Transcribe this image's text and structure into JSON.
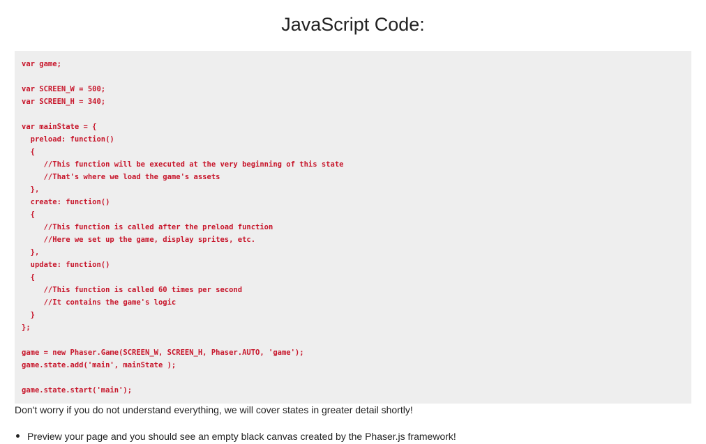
{
  "title": "JavaScript Code:",
  "code_lines": [
    "var game;",
    "",
    "var SCREEN_W = 500;",
    "var SCREEN_H = 340;",
    "",
    "var mainState = {",
    "  preload: function()",
    "  {",
    "     //This function will be executed at the very beginning of this state",
    "     //That's where we load the game's assets",
    "  },",
    "  create: function()",
    "  {",
    "     //This function is called after the preload function",
    "     //Here we set up the game, display sprites, etc.",
    "  },",
    "  update: function()",
    "  {",
    "     //This function is called 60 times per second",
    "     //It contains the game's logic",
    "  }",
    "};",
    "",
    "game = new Phaser.Game(SCREEN_W, SCREEN_H, Phaser.AUTO, 'game');",
    "game.state.add('main', mainState );",
    "",
    "game.state.start('main');"
  ],
  "note": "Don't worry if you do not understand everything, we will cover states in greater detail shortly!",
  "bullets": [
    "Preview your page and you should see an empty black canvas created by the Phaser.js framework!"
  ],
  "colors": {
    "code_text": "#c7152a",
    "code_background": "#eeeeee",
    "body_text": "#222222"
  }
}
